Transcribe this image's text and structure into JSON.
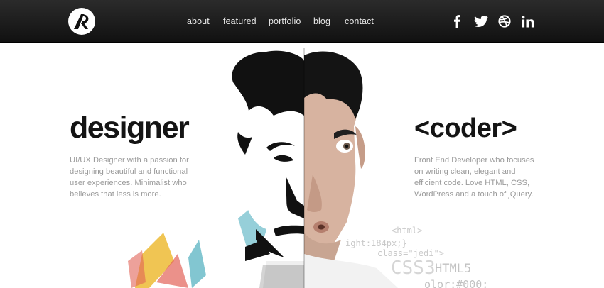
{
  "nav": {
    "items": [
      "about",
      "featured",
      "portfolio",
      "blog",
      "contact"
    ]
  },
  "social": [
    "facebook-icon",
    "twitter-icon",
    "dribbble-icon",
    "linkedin-icon"
  ],
  "hero": {
    "designer_title": "designer",
    "designer_text": "UI/UX Designer with a passion for designing beautiful and functional user experiences. Minimalist who believes that less is more.",
    "coder_title": "<coder>",
    "coder_text": "Front End Developer who focuses on writing clean, elegant and efficient code. Love HTML, CSS, WordPress and a touch of jQuery.",
    "code_snippets": [
      "<html>",
      "ight:184px;}",
      "class=\"jedi\">",
      "CSS3",
      "HTML5",
      "olor:#000;"
    ]
  },
  "colors": {
    "header_dark": "#1a1a1a",
    "accent_paint": [
      "#e05a4e",
      "#f0c24a",
      "#7cc3cf",
      "#2f3a4a"
    ]
  }
}
